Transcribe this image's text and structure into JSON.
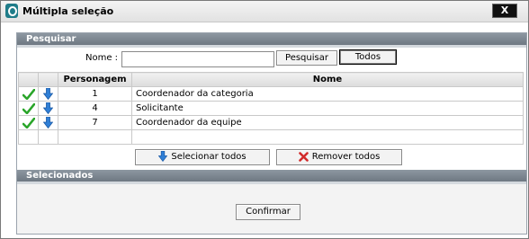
{
  "window": {
    "title": "Múltipla seleção",
    "close_label": "X"
  },
  "search": {
    "section_title": "Pesquisar",
    "name_label": "Nome :",
    "name_value": "",
    "search_button": "Pesquisar",
    "all_button": "Todos"
  },
  "table": {
    "columns": [
      "",
      "",
      "Personagem",
      "Nome"
    ],
    "rows": [
      {
        "id": "1",
        "name": "Coordenador da categoria"
      },
      {
        "id": "4",
        "name": "Solicitante"
      },
      {
        "id": "7",
        "name": "Coordenador da equipe"
      }
    ]
  },
  "actions": {
    "select_all": "Selecionar todos",
    "remove_all": "Remover todos"
  },
  "selected": {
    "section_title": "Selecionados",
    "confirm_button": "Confirmar"
  },
  "colors": {
    "header_bar": "#7a848e",
    "check_green": "#2aa52a",
    "arrow_blue": "#2f7fd6",
    "remove_red": "#d22b2b"
  }
}
